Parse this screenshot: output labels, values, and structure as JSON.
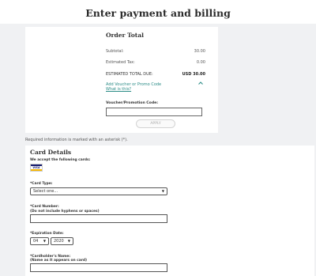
{
  "header": {
    "title": "Enter payment and billing"
  },
  "order": {
    "title": "Order Total",
    "subtotal_label": "Subtotal:",
    "subtotal_value": "30.00",
    "tax_label": "Estimated Tax:",
    "tax_value": "0.00",
    "total_label": "ESTIMATED TOTAL DUE:",
    "total_value": "USD 30.00",
    "voucher_link": "Add Voucher or Promo Code",
    "what_is_this": "What is this?",
    "voucher_label": "Voucher/Promotion Code:",
    "voucher_value": "",
    "apply_label": "APPLY"
  },
  "required_note": "Required information is marked with an asterisk (*).",
  "card": {
    "title": "Card Details",
    "accept_label": "We accept the following cards:",
    "visa_text": "VISA",
    "card_type_label": "*Card Type:",
    "card_type_value": "Select one...",
    "card_number_label": "*Card Number:",
    "card_number_hint": "(Do not include hyphens or spaces)",
    "card_number_value": "",
    "expiration_label": "*Expiration Date:",
    "exp_month": "04",
    "exp_year": "2020",
    "cardholder_label": "*Cardholder's Name:",
    "cardholder_hint": "(Name as it appears on card)",
    "cardholder_value": ""
  },
  "colors": {
    "link": "#2a8b86",
    "background": "#f0f1f3",
    "visa_blue": "#1a1f71",
    "visa_gold": "#f7b600"
  }
}
